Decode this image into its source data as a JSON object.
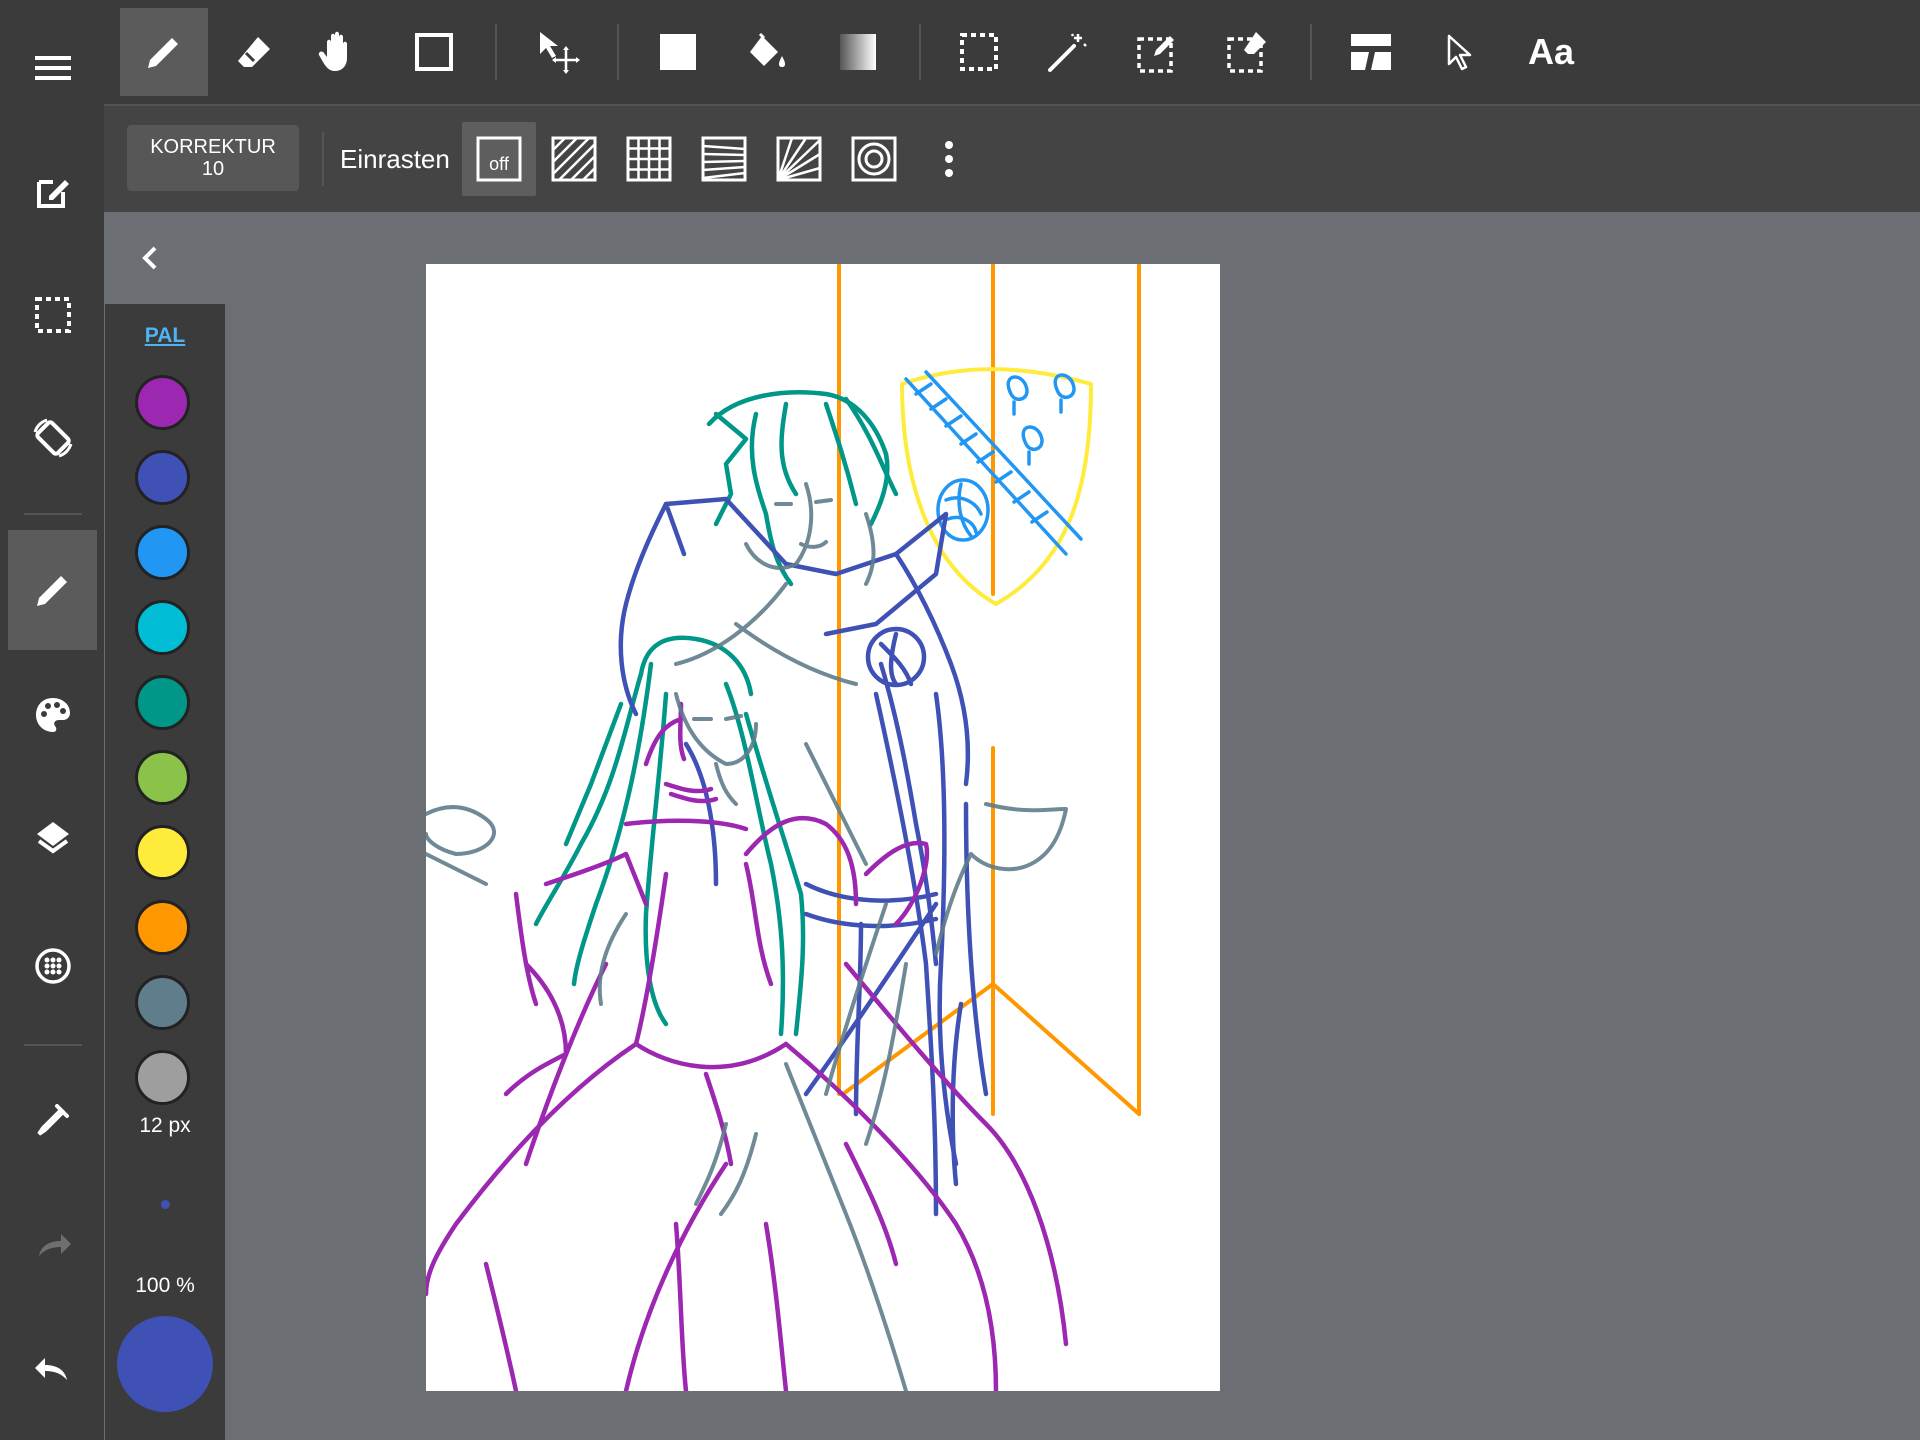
{
  "sidebar": {
    "items": [
      {
        "icon": "menu-icon"
      },
      {
        "icon": "edit-canvas-icon"
      },
      {
        "icon": "selection-icon"
      },
      {
        "icon": "rotate-screen-icon"
      },
      {
        "icon": "pen-icon",
        "active": true
      },
      {
        "icon": "palette-icon"
      },
      {
        "icon": "layers-icon"
      },
      {
        "icon": "material-icon"
      },
      {
        "icon": "eyedropper-icon"
      },
      {
        "icon": "redo-icon"
      },
      {
        "icon": "undo-icon"
      }
    ]
  },
  "toolbar": {
    "tools": [
      {
        "icon": "pen-icon",
        "active": true
      },
      {
        "icon": "eraser-icon"
      },
      {
        "icon": "hand-icon"
      },
      {
        "icon": "shape-icon"
      },
      {
        "icon": "move-icon"
      },
      {
        "icon": "fill-rect-icon"
      },
      {
        "icon": "bucket-icon"
      },
      {
        "icon": "gradient-icon"
      },
      {
        "icon": "select-rect-icon"
      },
      {
        "icon": "magic-wand-icon"
      },
      {
        "icon": "select-pen-icon"
      },
      {
        "icon": "select-eraser-icon"
      },
      {
        "icon": "frame-divider-icon"
      },
      {
        "icon": "operation-icon"
      },
      {
        "icon": "text-icon",
        "label": "Aa"
      }
    ]
  },
  "subbar": {
    "correction_label": "KORREKTUR",
    "correction_value": "10",
    "snap_label": "Einrasten",
    "snap_off_label": "off",
    "snap_modes": [
      "snap-off-icon",
      "parallel-line-icon",
      "grid-icon",
      "vanishing-line-icon",
      "radial-line-icon",
      "concentric-circle-icon",
      "more-icon"
    ]
  },
  "palette": {
    "label": "PAL",
    "colors": [
      "#9c27b0",
      "#3f51b5",
      "#2196f3",
      "#00bcd4",
      "#009688",
      "#8bc34a",
      "#ffeb3b",
      "#ff9800",
      "#607d8b",
      "#9e9e9e"
    ],
    "brush_size": "12 px",
    "opacity": "100 %",
    "current_color": "#3f51b5"
  },
  "colors": {
    "bar_bg": "#3b3b3b",
    "subbar_bg": "#444444",
    "workspace_bg": "#6b6e73",
    "active_bg": "#5b5b5b",
    "accent": "#4fb3f2"
  }
}
